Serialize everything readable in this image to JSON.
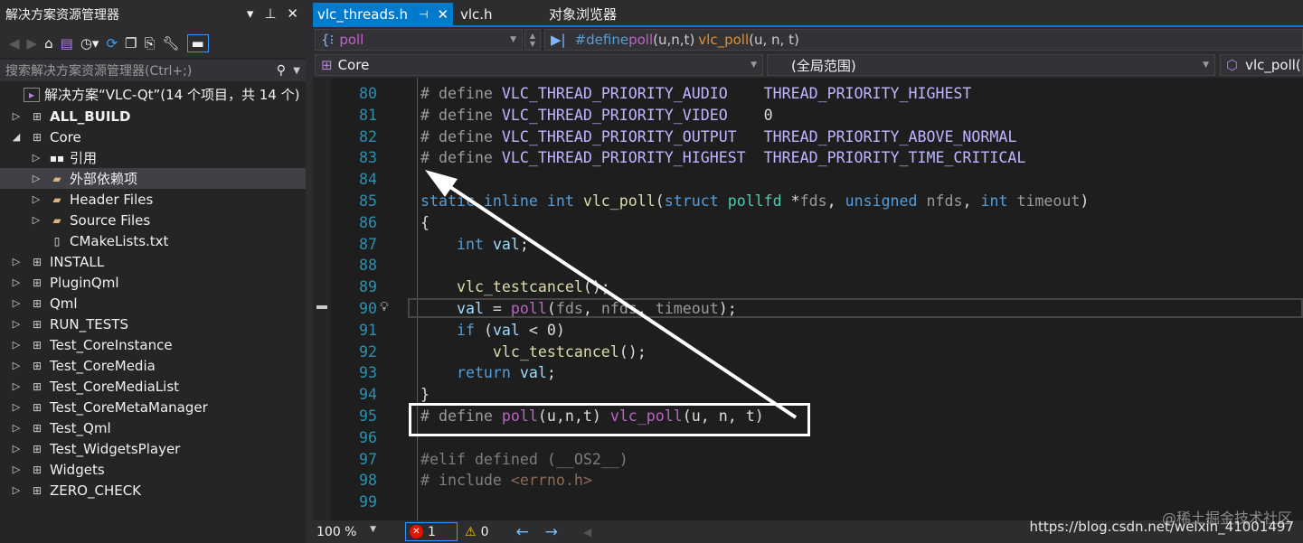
{
  "sidebar": {
    "title": "解决方案资源管理器",
    "title_controls": [
      "▾",
      "⊥",
      "✕"
    ],
    "search_placeholder": "搜索解决方案资源管理器(Ctrl+;)",
    "solution": "解决方案“VLC-Qt”(14 个项目，共 14 个)",
    "items": [
      {
        "label": "ALL_BUILD",
        "bold": true,
        "expander": "▷",
        "level": 0
      },
      {
        "label": "Core",
        "expander": "◢",
        "level": 0
      },
      {
        "label": "引用",
        "expander": "▷",
        "level": 1
      },
      {
        "label": "外部依赖项",
        "expander": "▷",
        "level": 1,
        "selected": true
      },
      {
        "label": "Header Files",
        "expander": "▷",
        "level": 1
      },
      {
        "label": "Source Files",
        "expander": "▷",
        "level": 1
      },
      {
        "label": "CMakeLists.txt",
        "expander": "",
        "level": 1
      },
      {
        "label": "INSTALL",
        "expander": "▷",
        "level": 0
      },
      {
        "label": "PluginQml",
        "expander": "▷",
        "level": 0
      },
      {
        "label": "Qml",
        "expander": "▷",
        "level": 0
      },
      {
        "label": "RUN_TESTS",
        "expander": "▷",
        "level": 0
      },
      {
        "label": "Test_CoreInstance",
        "expander": "▷",
        "level": 0
      },
      {
        "label": "Test_CoreMedia",
        "expander": "▷",
        "level": 0
      },
      {
        "label": "Test_CoreMediaList",
        "expander": "▷",
        "level": 0
      },
      {
        "label": "Test_CoreMetaManager",
        "expander": "▷",
        "level": 0
      },
      {
        "label": "Test_Qml",
        "expander": "▷",
        "level": 0
      },
      {
        "label": "Test_WidgetsPlayer",
        "expander": "▷",
        "level": 0
      },
      {
        "label": "Widgets",
        "expander": "▷",
        "level": 0
      },
      {
        "label": "ZERO_CHECK",
        "expander": "▷",
        "level": 0
      }
    ]
  },
  "tabs": [
    {
      "label": "vlc_threads.h",
      "active": true
    },
    {
      "label": "vlc.h"
    },
    {
      "label": "对象浏览器"
    }
  ],
  "nav": {
    "symbol": "poll",
    "definition": {
      "pp": "#define ",
      "a": "poll",
      "b": "(u,n,t) ",
      "c": "vlc_poll",
      "d": "(u, n, t)"
    },
    "project": "Core",
    "scope": "(全局范围)",
    "member": "vlc_poll(p"
  },
  "code": [
    {
      "n": "80",
      "t": [
        [
          "# define ",
          "pp"
        ],
        [
          "VLC_THREAD_PRIORITY_AUDIO    ",
          "mac"
        ],
        [
          "THREAD_PRIORITY_HIGHEST",
          "mac"
        ]
      ]
    },
    {
      "n": "81",
      "t": [
        [
          "# define ",
          "pp"
        ],
        [
          "VLC_THREAD_PRIORITY_VIDEO    ",
          "mac"
        ],
        [
          "0",
          "pl"
        ]
      ]
    },
    {
      "n": "82",
      "t": [
        [
          "# define ",
          "pp"
        ],
        [
          "VLC_THREAD_PRIORITY_OUTPUT   ",
          "mac"
        ],
        [
          "THREAD_PRIORITY_ABOVE_NORMAL",
          "mac"
        ]
      ]
    },
    {
      "n": "83",
      "t": [
        [
          "# define ",
          "pp"
        ],
        [
          "VLC_THREAD_PRIORITY_HIGHEST  ",
          "mac"
        ],
        [
          "THREAD_PRIORITY_TIME_CRITICAL",
          "mac"
        ]
      ]
    },
    {
      "n": "84",
      "t": []
    },
    {
      "n": "85",
      "t": [
        [
          "static inline int ",
          "kw"
        ],
        [
          "vlc_poll",
          "fn"
        ],
        [
          "(",
          "pl"
        ],
        [
          "struct ",
          "kw"
        ],
        [
          "pollfd ",
          "ty"
        ],
        [
          "*",
          "pl"
        ],
        [
          "fds",
          "par"
        ],
        [
          ", ",
          "pl"
        ],
        [
          "unsigned ",
          "kw"
        ],
        [
          "nfds",
          "par"
        ],
        [
          ", ",
          "pl"
        ],
        [
          "int ",
          "kw"
        ],
        [
          "timeout",
          "par"
        ],
        [
          ")",
          "pl"
        ]
      ]
    },
    {
      "n": "86",
      "t": [
        [
          "{",
          "pl"
        ]
      ]
    },
    {
      "n": "87",
      "t": [
        [
          "    int ",
          "kw"
        ],
        [
          "val",
          "loc"
        ],
        [
          ";",
          "pl"
        ]
      ]
    },
    {
      "n": "88",
      "t": []
    },
    {
      "n": "89",
      "t": [
        [
          "    vlc_testcancel",
          "fn"
        ],
        [
          "();",
          "pl"
        ]
      ]
    },
    {
      "n": "90",
      "t": [
        [
          "    val",
          "loc"
        ],
        [
          " = ",
          "pl"
        ],
        [
          "poll",
          "mac2"
        ],
        [
          "(",
          "pl"
        ],
        [
          "fds",
          "par"
        ],
        [
          ", ",
          "pl"
        ],
        [
          "nfds",
          "par"
        ],
        [
          ", ",
          "pl"
        ],
        [
          "timeout",
          "par"
        ],
        [
          ");",
          "pl"
        ]
      ]
    },
    {
      "n": "91",
      "t": [
        [
          "    if ",
          "kw"
        ],
        [
          "(",
          "pl"
        ],
        [
          "val",
          "loc"
        ],
        [
          " < 0)",
          "pl"
        ]
      ]
    },
    {
      "n": "92",
      "t": [
        [
          "        vlc_testcancel",
          "fn"
        ],
        [
          "();",
          "pl"
        ]
      ]
    },
    {
      "n": "93",
      "t": [
        [
          "    return ",
          "kw"
        ],
        [
          "val",
          "loc"
        ],
        [
          ";",
          "pl"
        ]
      ]
    },
    {
      "n": "94",
      "t": [
        [
          "}",
          "pl"
        ]
      ]
    },
    {
      "n": "95",
      "t": [
        [
          "# define ",
          "pp"
        ],
        [
          "poll",
          "mac2"
        ],
        [
          "(u,n,t) ",
          "pl"
        ],
        [
          "vlc_poll",
          "mac2"
        ],
        [
          "(u, n, t)",
          "pl"
        ]
      ]
    },
    {
      "n": "96",
      "t": []
    },
    {
      "n": "97",
      "t": [
        [
          "#elif defined (__OS2__)",
          "dim"
        ]
      ]
    },
    {
      "n": "98",
      "t": [
        [
          "# include ",
          "dim"
        ],
        [
          "<errno.h>",
          "str"
        ]
      ]
    },
    {
      "n": "99",
      "t": []
    }
  ],
  "status": {
    "zoom": "100 %",
    "errors": "1",
    "warnings": "0"
  },
  "watermark": {
    "community": "@稀土掘金技术社区",
    "url": "https://blog.csdn.net/weixin_41001497"
  }
}
